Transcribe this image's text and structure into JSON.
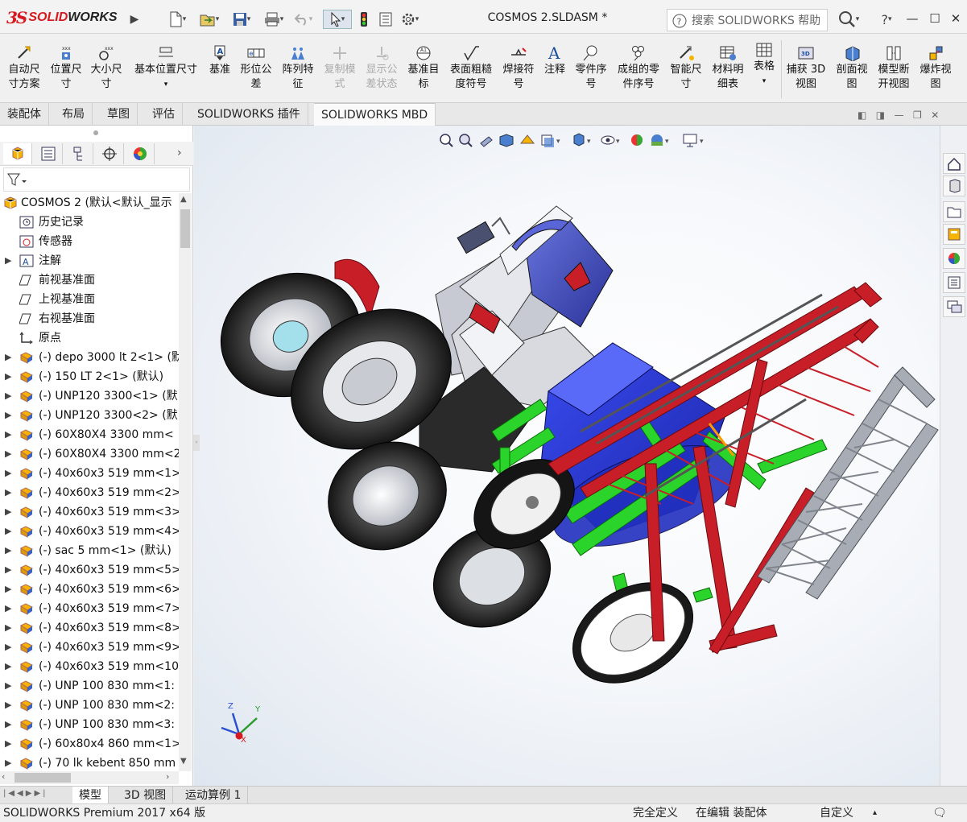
{
  "app": {
    "brand_ds": "3S",
    "brand_name_1": "SOLID",
    "brand_name_2": "WORKS"
  },
  "title_bar": {
    "document_title": "COSMOS 2.SLDASM *",
    "search_placeholder": "搜索 SOLIDWORKS 帮助",
    "help_label": "?"
  },
  "toolbar": {
    "buttons": [
      {
        "label1": "自动尺",
        "label2": "寸方案"
      },
      {
        "label1": "位置尺",
        "label2": "寸"
      },
      {
        "label1": "大小尺",
        "label2": "寸"
      },
      {
        "label1": "基本位置尺寸",
        "label2": ""
      },
      {
        "label1": "基准",
        "label2": ""
      },
      {
        "label1": "形位公",
        "label2": "差"
      },
      {
        "label1": "阵列特",
        "label2": "征"
      },
      {
        "label1": "复制模",
        "label2": "式"
      },
      {
        "label1": "显示公",
        "label2": "差状态"
      },
      {
        "label1": "基准目",
        "label2": "标"
      },
      {
        "label1": "表面粗糙",
        "label2": "度符号"
      },
      {
        "label1": "焊接符",
        "label2": "号"
      },
      {
        "label1": "注释",
        "label2": ""
      },
      {
        "label1": "零件序",
        "label2": "号"
      },
      {
        "label1": "成组的零",
        "label2": "件序号"
      },
      {
        "label1": "智能尺",
        "label2": "寸"
      },
      {
        "label1": "材料明",
        "label2": "细表"
      },
      {
        "label1": "表格",
        "label2": ""
      },
      {
        "label1": "捕获 3D",
        "label2": "视图"
      },
      {
        "label1": "剖面视",
        "label2": "图"
      },
      {
        "label1": "模型断",
        "label2": "开视图"
      },
      {
        "label1": "爆炸视",
        "label2": "图"
      }
    ]
  },
  "command_tabs": [
    "装配体",
    "布局",
    "草图",
    "评估",
    "SOLIDWORKS 插件",
    "SOLIDWORKS MBD"
  ],
  "tree": {
    "root": "COSMOS 2  (默认<默认_显示",
    "items": [
      "历史记录",
      "传感器",
      "注解",
      "前视基准面",
      "上视基准面",
      "右视基准面",
      "原点",
      "(-) depo 3000 lt 2<1> (默",
      "(-) 150 LT 2<1> (默认)",
      "(-) UNP120 3300<1> (默",
      "(-) UNP120 3300<2> (默",
      "(-) 60X80X4 3300 mm<",
      "(-) 60X80X4 3300 mm<2",
      "(-) 40x60x3 519 mm<1>",
      "(-) 40x60x3 519 mm<2>",
      "(-) 40x60x3 519 mm<3>",
      "(-) 40x60x3 519 mm<4>",
      "(-) sac 5 mm<1> (默认)",
      "(-) 40x60x3 519 mm<5>",
      "(-) 40x60x3 519 mm<6>",
      "(-) 40x60x3 519 mm<7>",
      "(-) 40x60x3 519 mm<8>",
      "(-) 40x60x3 519 mm<9>",
      "(-) 40x60x3 519 mm<10",
      "(-) UNP 100 830 mm<1:",
      "(-) UNP 100 830 mm<2:",
      "(-) UNP 100 830 mm<3:",
      "(-) 60x80x4 860 mm<1>",
      "(-) 70 lk kebent 850 mm"
    ]
  },
  "bottom_tabs": [
    "模型",
    "3D 视图",
    "运动算例 1"
  ],
  "status_bar": {
    "left": "SOLIDWORKS Premium 2017 x64 版",
    "state": "完全定义",
    "mode": "在编辑 装配体",
    "custom": "自定义"
  },
  "triad": {
    "z": "Z",
    "x": "X",
    "y": "Y"
  },
  "colors": {
    "brand_red": "#d71920",
    "tank_blue": "#2a3ad6",
    "frame_red": "#b5141c",
    "frame_green": "#2ad42a",
    "boom_grey": "#9a9ea6"
  }
}
